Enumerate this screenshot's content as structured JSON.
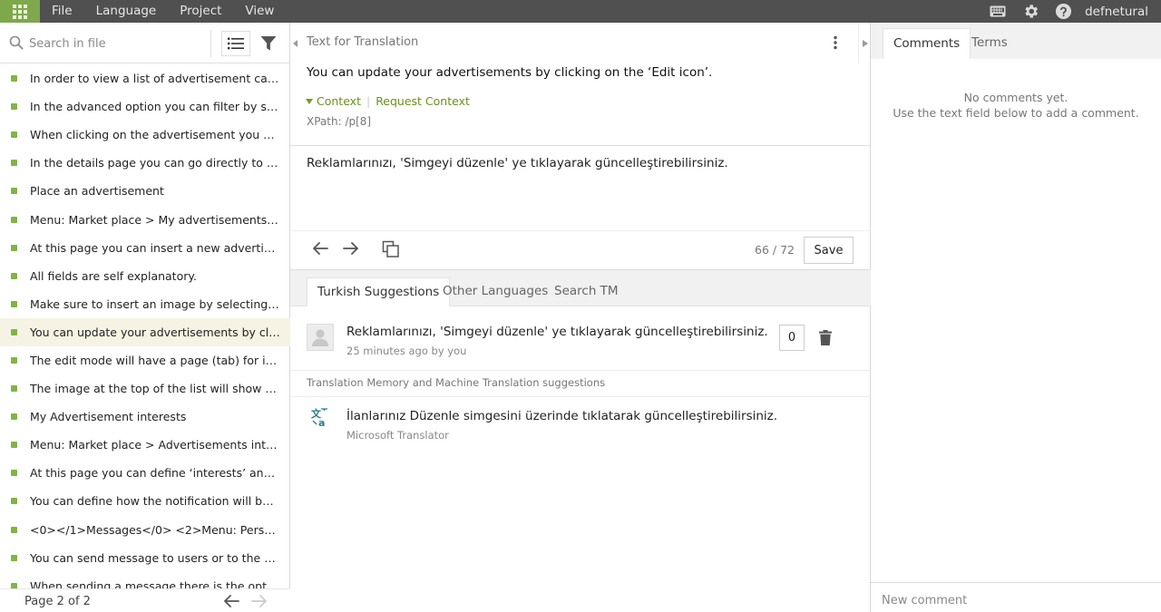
{
  "topbar": {
    "menu": [
      "File",
      "Language",
      "Project",
      "View"
    ],
    "username": "defnetural",
    "icons": [
      "grid-icon",
      "keyboard-icon",
      "gear-icon",
      "help-icon"
    ]
  },
  "left": {
    "search_placeholder": "Search in file",
    "entities": [
      "In order to view a list of advertisement categories...",
      "In the advanced option you can filter by specific c...",
      "When clicking on the advertisement you will acce...",
      "In the details page you can go directly to the profi...",
      "Place an advertisement",
      "Menu: Market place > My advertisements > New",
      "At this page you can insert a new advertisement.",
      "All fields are self explanatory.",
      "Make sure to insert an image by selecting the ‘im...",
      "You can update your advertisements by clicking o...",
      "The edit mode will have a page (tab) for images.",
      "The image at the top of the list will show up in th...",
      "My Advertisement interests",
      "Menu: Market place > Advertisements interests",
      "At this page you can define ‘interests’ and receive...",
      "You can define how the notification will be sent i...",
      "<0></1>Messages</0> <2>Menu: Personal > Infor...",
      "You can send message to users or to the adminis...",
      "When sending a message there is the option to..."
    ],
    "active_index": 9,
    "status_color": "#7fb544",
    "pager": {
      "label": "Page 2 of 2"
    }
  },
  "editor": {
    "source_heading": "Text for Translation",
    "source_text": "You can update your advertisements by clicking on the ‘Edit icon’.",
    "context_label": "Context",
    "request_context_label": "Request Context",
    "xpath": "XPath: /p[8]",
    "translation": "Reklamlarınızı, 'Simgeyi düzenle' ye tıklayarak güncelleştirebilirsiniz.",
    "progress": "66 / 72",
    "save_label": "Save",
    "tabs": [
      "Turkish Suggestions",
      "Other Languages",
      "Search TM"
    ],
    "active_tab": 0,
    "suggestion": {
      "text": "Reklamlarınızı, 'Simgeyi düzenle' ye tıklayarak güncelleştirebilirsiniz.",
      "meta": "25 minutes ago by you",
      "votes": "0"
    },
    "tm_heading": "Translation Memory and Machine Translation suggestions",
    "machine": {
      "text": "İlanlarınız Düzenle simgesini üzerinde tıklatarak güncelleştirebilirsiniz.",
      "source": "Microsoft Translator"
    }
  },
  "right": {
    "tabs": [
      "Comments",
      "Terms"
    ],
    "no_comments_line1": "No comments yet.",
    "no_comments_line2": "Use the text field below to add a comment.",
    "comment_placeholder": "New comment"
  },
  "colors": {
    "accent": "#7fa84b",
    "link": "#6a8f1c",
    "topbar": "#505050",
    "active_row": "#f6f3e4"
  }
}
